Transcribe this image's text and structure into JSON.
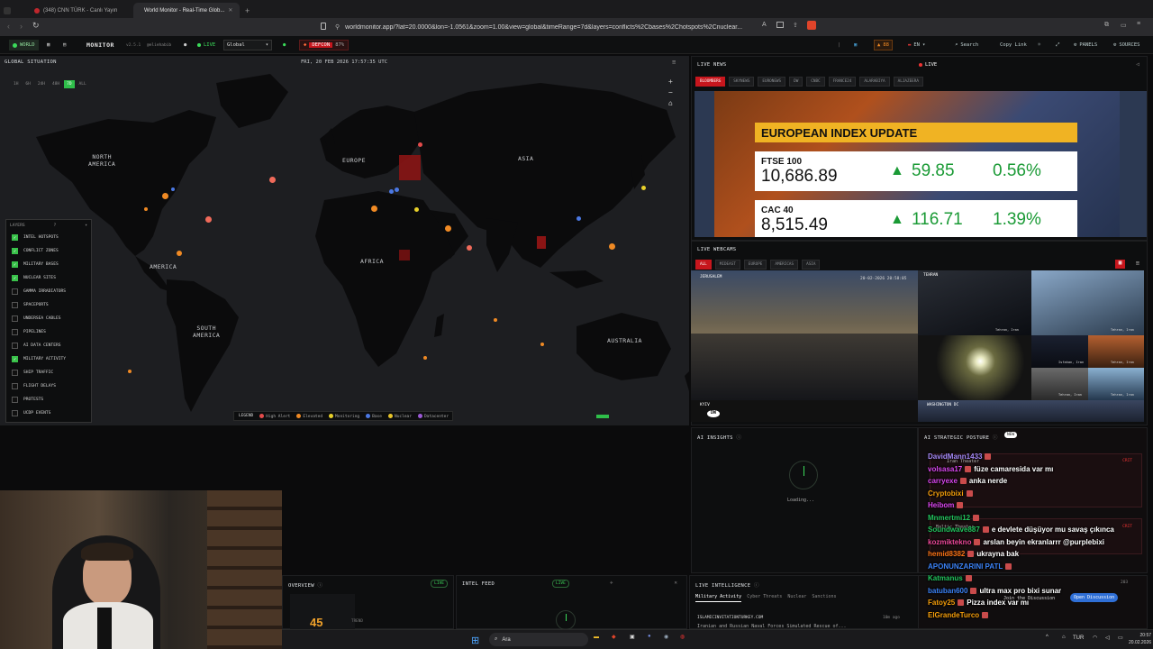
{
  "browser": {
    "tabs": [
      {
        "label": "(348) CNN TÜRK - Canlı Yayın",
        "active": false
      },
      {
        "label": "World Monitor - Real-Time Glob...",
        "active": true
      }
    ],
    "url": "worldmonitor.app/?lat=20.0000&lon=-1.0561&zoom=1.00&view=global&timeRange=7d&layers=conflicts%2Cbases%2Chotspots%2Cnuclear..."
  },
  "app": {
    "brand": "MONITOR",
    "world_tab": "WORLD",
    "version": "v2.5.1",
    "handle": "@eliehabib",
    "live_label": "LIVE",
    "region_select": "Global",
    "defcon_label": "DEFCON",
    "defcon_pct": "87%",
    "count_badge": "88",
    "lang": "EN",
    "search_label": "Search",
    "copy_link": "Copy Link",
    "panels": "PANELS",
    "sources": "SOURCES"
  },
  "map": {
    "title": "GLOBAL SITUATION",
    "timestamp": "FRI, 20 FEB 2026 17:57:35 UTC",
    "time_ranges": [
      "1H",
      "6H",
      "24H",
      "48H",
      "7D",
      "ALL"
    ],
    "active_range": "7D",
    "continents": [
      {
        "label": "NORTH AMERICA",
        "line1": "NORTH",
        "line2": "AMERICA"
      },
      {
        "label": "EUROPE",
        "line1": "EUROPE",
        "line2": ""
      },
      {
        "label": "ASIA",
        "line1": "ASIA",
        "line2": ""
      },
      {
        "label": "AMERICA",
        "line1": "AMERICA",
        "line2": ""
      },
      {
        "label": "AFRICA",
        "line1": "AFRICA",
        "line2": ""
      },
      {
        "label": "SOUTH AMERICA",
        "line1": "SOUTH",
        "line2": "AMERICA"
      },
      {
        "label": "AUSTRALIA",
        "line1": "AUSTRALIA",
        "line2": ""
      }
    ],
    "layers_title": "LAYERS",
    "layers": [
      {
        "label": "INTEL HOTSPOTS",
        "on": true
      },
      {
        "label": "CONFLICT ZONES",
        "on": true
      },
      {
        "label": "MILITARY BASES",
        "on": true
      },
      {
        "label": "NUCLEAR SITES",
        "on": true
      },
      {
        "label": "GAMMA IRRADIATORS",
        "on": false
      },
      {
        "label": "SPACEPORTS",
        "on": false
      },
      {
        "label": "UNDERSEA CABLES",
        "on": false
      },
      {
        "label": "PIPELINES",
        "on": false
      },
      {
        "label": "AI DATA CENTERS",
        "on": false
      },
      {
        "label": "MILITARY ACTIVITY",
        "on": true
      },
      {
        "label": "SHIP TRAFFIC",
        "on": false
      },
      {
        "label": "FLIGHT DELAYS",
        "on": false
      },
      {
        "label": "PROTESTS",
        "on": false
      },
      {
        "label": "UCDP EVENTS",
        "on": false
      }
    ],
    "legend_title": "LEGEND",
    "legend": [
      {
        "label": "High Alert",
        "color": "#e34b4b"
      },
      {
        "label": "Elevated",
        "color": "#f08a24"
      },
      {
        "label": "Monitoring",
        "color": "#e8d02a"
      },
      {
        "label": "Base",
        "color": "#4b78e3"
      },
      {
        "label": "Nuclear",
        "color": "#e8c42a"
      },
      {
        "label": "Datacenter",
        "color": "#9b59d6"
      }
    ]
  },
  "live_news": {
    "title": "LIVE NEWS",
    "live": "LIVE",
    "channels": [
      "BLOOMBERG",
      "SKYNEWS",
      "EURONEWS",
      "DW",
      "CNBC",
      "FRANCE24",
      "ALARABIYA",
      "ALJAZEERA"
    ],
    "active_channel": "BLOOMBERG",
    "video_header": "EUROPEAN INDEX UPDATE",
    "indices": [
      {
        "name": "FTSE 100",
        "value": "10,686.89",
        "change": "59.85",
        "pct": "0.56%"
      },
      {
        "name": "CAC 40",
        "value": "8,515.49",
        "change": "116.71",
        "pct": "1.39%"
      }
    ]
  },
  "webcams": {
    "title": "LIVE WEBCAMS",
    "filters": [
      "ALL",
      "MIDEAST",
      "EUROPE",
      "AMERICAS",
      "ASIA"
    ],
    "active_filter": "ALL",
    "cams": [
      {
        "label": "JERUSALEM"
      },
      {
        "label": "TEHRAN"
      },
      {
        "label": "KYIV"
      },
      {
        "label": "WASHINGTON DC"
      }
    ],
    "cam_captions": [
      "Tehran, Iran",
      "Tehran, Iran",
      "Isfahan, Iran",
      "Tehran, Iran",
      "Tehran, Iran",
      "Tehran, Iran"
    ],
    "date_overlay": "20-02-2026 20:58:05"
  },
  "ai_insights": {
    "title": "AI INSIGHTS",
    "status": "Loading..."
  },
  "ai_posture": {
    "title": "AI STRATEGIC POSTURE",
    "badge": "NEW",
    "theater1": "Iran Theater",
    "theater2": "Baltic Theater",
    "crit": "CRIT",
    "join": "Join the Discussion",
    "open_btn": "Open Discussion"
  },
  "bottom_panels": {
    "overview": {
      "title": "OVERVIEW",
      "live": "LIVE",
      "value": "45",
      "trend": "TREND"
    },
    "intel_feed": {
      "title": "INTEL FEED",
      "live": "LIVE"
    },
    "live_intel": {
      "title": "LIVE INTELLIGENCE",
      "tabs": [
        "Military Activity",
        "Cyber Threats",
        "Nuclear",
        "Sanctions"
      ],
      "active_tab": "Military Activity",
      "source": "ISLAMICINVITATIONTURKEY.COM",
      "age": "10m ago",
      "headline": "Iranian and Russian Naval Forces Simulated Rescue of...",
      "count": "203"
    }
  },
  "chat": [
    {
      "user": "DavidMann1433",
      "text": "",
      "color": "#a78bfa"
    },
    {
      "user": "volsasa17",
      "text": "füze camaresida var mı",
      "color": "#d946ef"
    },
    {
      "user": "carryexe",
      "text": "anka nerde",
      "color": "#d946ef"
    },
    {
      "user": "Cryptobixi",
      "text": "",
      "color": "#f59e0b"
    },
    {
      "user": "Heibom",
      "text": "",
      "color": "#d946ef"
    },
    {
      "user": "Mnmertmi12",
      "text": "",
      "color": "#22c55e"
    },
    {
      "user": "Soundwave887",
      "text": "e devlete düşüyor mu savaş çıkınca",
      "color": "#22c55e"
    },
    {
      "user": "kozmiktekno",
      "text": "arslan beyin ekranlarrr @purplebixi",
      "color": "#ec4899"
    },
    {
      "user": "hemid8382",
      "text": "ukrayna bak",
      "color": "#f97316"
    },
    {
      "user": "APONUNZARINI PATL",
      "text": "",
      "color": "#3b82f6"
    },
    {
      "user": "Katmanus",
      "text": "",
      "color": "#22c55e"
    },
    {
      "user": "batuban600",
      "text": "ultra max pro bixi sunar",
      "color": "#3b82f6"
    },
    {
      "user": "Fatoy25",
      "text": "Pizza index var mı",
      "color": "#f59e0b"
    },
    {
      "user": "ElGrandeTurco",
      "text": "",
      "color": "#f59e0b"
    }
  ],
  "taskbar": {
    "search": "Ara",
    "lang": "TUR",
    "time": "20:57",
    "date": "20.02.2026"
  }
}
